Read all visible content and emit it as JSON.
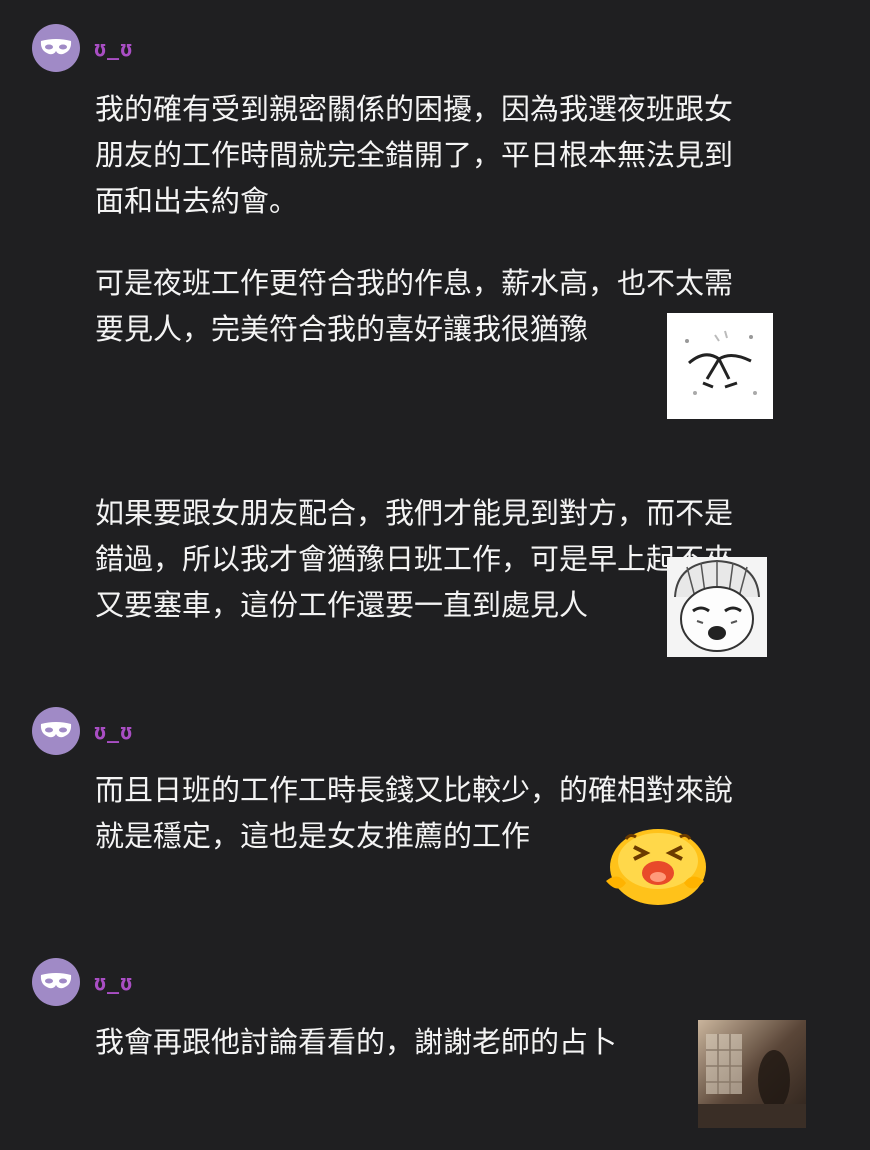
{
  "colors": {
    "background": "#1f1f21",
    "avatar": "#a08ac6",
    "username": "#a94ec4",
    "text": "#f4f4f4"
  },
  "messages": [
    {
      "username": "ʊ_ʊ",
      "avatar_icon": "mask-icon",
      "paragraphs": [
        "我的確有受到親密關係的困擾，因為我選夜班跟女\n朋友的工作時間就完全錯開了，平日根本無法見到\n面和出去約會。",
        "可是夜班工作更符合我的作息，薪水高，也不太需\n要見人，完美符合我的喜好讓我很猶豫",
        "如果要跟女朋友配合，我們才能見到對方，而不是\n錯過，所以我才會猶豫日班工作，可是早上起不來\n又要塞車，這份工作還要一直到處見人"
      ],
      "stickers": [
        "crying-doodle-sticker",
        "shocked-manga-face-sticker"
      ]
    },
    {
      "username": "ʊ_ʊ",
      "avatar_icon": "mask-icon",
      "paragraphs": [
        "而且日班的工作工時長錢又比較少，的確相對來說\n就是穩定，這也是女友推薦的工作"
      ],
      "stickers": [
        "crying-emoji-sticker"
      ]
    },
    {
      "username": "ʊ_ʊ",
      "avatar_icon": "mask-icon",
      "paragraphs": [
        "我會再跟他討論看看的，謝謝老師的占卜"
      ],
      "stickers": [
        "dim-photo-sticker"
      ]
    }
  ]
}
